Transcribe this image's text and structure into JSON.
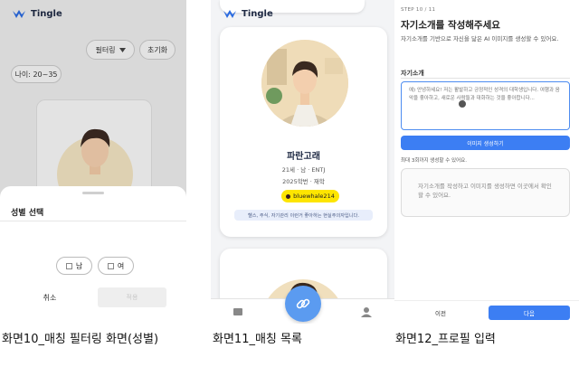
{
  "app_name": "Tingle",
  "colors": {
    "primary": "#3c7ef3",
    "brand": "#1f2a44",
    "kakao": "#fde500",
    "fab": "#5b9bf0"
  },
  "screen1": {
    "filter_label": "필터링",
    "reset_label": "초기화",
    "age_chip": "나이: 20~35",
    "sheet_title": "성별 선택",
    "male_label": "남",
    "female_label": "여",
    "cancel_label": "취소",
    "apply_label": "적용"
  },
  "screen2": {
    "name": "파란고래",
    "meta": "21세 · 남 · ENTJ",
    "meta2": "2025학번 · 재학",
    "kakao_id": "bluewhale214",
    "bio": "헬스, 주식, 자기관리 이런거 좋아하는 현실주의자입니다."
  },
  "screen3": {
    "step": "STEP 10 / 11",
    "title": "자기소개를 작성해주세요",
    "subtitle": "자기소개를 기반으로 자신을 닮은 AI 이미지를 생성할 수 있어요.",
    "field_label": "자기소개",
    "textarea_placeholder": "예) 안녕하세요! 저는 활발하고 긍정적인 성격의 대학생입니다. 여행과 음악을 좋아하고, 새로운 사람들과 대화하는 것을 좋아합니다...",
    "generate_button": "이미지 생성하기",
    "generate_note": "최대 3회까지 생성할 수 있어요.",
    "result_text": "자기소개를 작성하고 이미지를 생성하면 이곳에서 확인할 수 있어요.",
    "prev_button": "이전",
    "next_button": "다음"
  },
  "captions": {
    "screen1": "화면10_매칭 필터링 화면(성별)",
    "screen2": "화면11_매칭 목록",
    "screen3": "화면12_프로필 입력"
  }
}
